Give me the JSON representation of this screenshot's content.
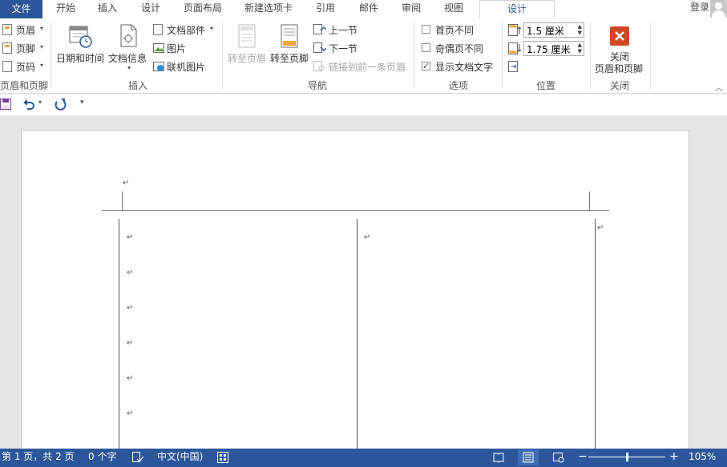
{
  "tabs": {
    "file": "文件",
    "home": "开始",
    "insert": "插入",
    "design1": "设计",
    "layout": "页面布局",
    "newtab": "新建选项卡",
    "references": "引用",
    "mailings": "邮件",
    "review": "审阅",
    "view": "视图",
    "design_active": "设计",
    "login": "登录"
  },
  "ribbon": {
    "hf_group": {
      "header": "页眉",
      "footer": "页脚",
      "pagenum": "页码",
      "label": "页眉和页脚"
    },
    "insert_group": {
      "datetime": "日期和时间",
      "docinfo": "文档信息",
      "quickparts": "文档部件",
      "picture": "图片",
      "online_picture": "联机图片",
      "label": "插入"
    },
    "nav_group": {
      "goto_header": "转至页眉",
      "goto_footer": "转至页脚",
      "prev": "上一节",
      "next": "下一节",
      "link_prev": "链接到前一条页眉",
      "label": "导航"
    },
    "options_group": {
      "diff_first": "首页不同",
      "diff_odd_even": "奇偶页不同",
      "show_text": "显示文档文字",
      "show_text_checked": true,
      "label": "选项"
    },
    "position_group": {
      "header_pos": "1.5 厘米",
      "footer_pos": "1.75 厘米",
      "label": "位置"
    },
    "close_group": {
      "close_line1": "关闭",
      "close_line2": "页眉和页脚",
      "label": "关闭"
    }
  },
  "status": {
    "page": "第 1 页，共 2 页",
    "words": "0 个字",
    "language": "中文(中国)",
    "zoom": "105%"
  },
  "doc": {
    "para_mark": "↵"
  },
  "colors": {
    "accent": "#2b579a",
    "close_red": "#d24726"
  }
}
